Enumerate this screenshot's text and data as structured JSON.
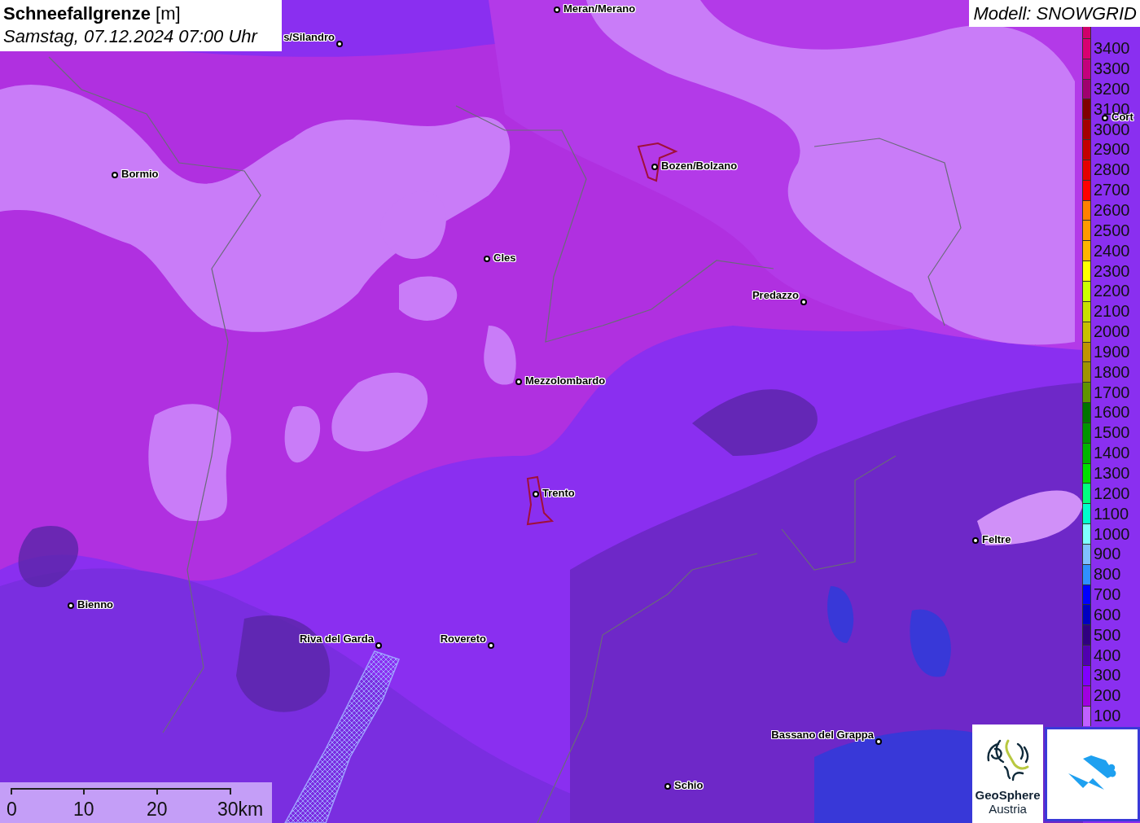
{
  "title": {
    "heading": "**Schneefallgrenze** [m]",
    "datetime": "Samstag, 07.12.2024 07:00 Uhr"
  },
  "model_label": "Modell: SNOWGRID",
  "places": [
    {
      "name": "Meran/Merano",
      "kind": "right"
    },
    {
      "name": "s/Silandro",
      "kind": "left"
    },
    {
      "name": "Bormio",
      "kind": "right"
    },
    {
      "name": "Bozen/Bolzano",
      "kind": "right"
    },
    {
      "name": "Cort",
      "kind": "right"
    },
    {
      "name": "Cles",
      "kind": "right"
    },
    {
      "name": "Predazzo",
      "kind": "left"
    },
    {
      "name": "Mezzolombardo",
      "kind": "right"
    },
    {
      "name": "Trento",
      "kind": "right"
    },
    {
      "name": "Feltre",
      "kind": "right"
    },
    {
      "name": "Bienno",
      "kind": "right"
    },
    {
      "name": "Riva del Garda",
      "kind": "left"
    },
    {
      "name": "Rovereto",
      "kind": "left"
    },
    {
      "name": "Bassano del Grappa",
      "kind": "left"
    },
    {
      "name": "Schio",
      "kind": "right"
    }
  ],
  "legend": [
    {
      "color": "#d0006a"
    },
    {
      "label": "3400",
      "color": "#d80070"
    },
    {
      "label": "3300",
      "color": "#c4007c"
    },
    {
      "label": "3200",
      "color": "#a0006e"
    },
    {
      "label": "3100",
      "color": "#800000"
    },
    {
      "label": "3000",
      "color": "#a40000"
    },
    {
      "label": "2900",
      "color": "#c40000"
    },
    {
      "label": "2800",
      "color": "#e40000"
    },
    {
      "label": "2700",
      "color": "#ff0000"
    },
    {
      "label": "2600",
      "color": "#ff8000"
    },
    {
      "label": "2500",
      "color": "#ff9a00"
    },
    {
      "label": "2400",
      "color": "#ffb400"
    },
    {
      "label": "2300",
      "color": "#ffff00"
    },
    {
      "label": "2200",
      "color": "#ccff00"
    },
    {
      "label": "2100",
      "color": "#c8e000"
    },
    {
      "label": "2000",
      "color": "#c8c000"
    },
    {
      "label": "1900",
      "color": "#c09400"
    },
    {
      "label": "1800",
      "color": "#a09400"
    },
    {
      "label": "1700",
      "color": "#609400"
    },
    {
      "label": "1600",
      "color": "#007400"
    },
    {
      "label": "1500",
      "color": "#009400"
    },
    {
      "label": "1400",
      "color": "#00b400"
    },
    {
      "label": "1300",
      "color": "#00e000"
    },
    {
      "label": "1200",
      "color": "#00ff80"
    },
    {
      "label": "1100",
      "color": "#00ffcc"
    },
    {
      "label": "1000",
      "color": "#80ffff"
    },
    {
      "label": "900",
      "color": "#80c0ff"
    },
    {
      "label": "800",
      "color": "#3090ff"
    },
    {
      "label": "700",
      "color": "#0000ff"
    },
    {
      "label": "600",
      "color": "#0000c0"
    },
    {
      "label": "500",
      "color": "#300080"
    },
    {
      "label": "400",
      "color": "#5000b0"
    },
    {
      "label": "300",
      "color": "#8000ff"
    },
    {
      "label": "200",
      "color": "#a000e0"
    },
    {
      "label": "100",
      "color": "#c060ff"
    }
  ],
  "scale_bar": [
    "0",
    "10",
    "20",
    "30km"
  ],
  "logo": {
    "line_1": "GeoSphere",
    "line_2": "Austria"
  }
}
